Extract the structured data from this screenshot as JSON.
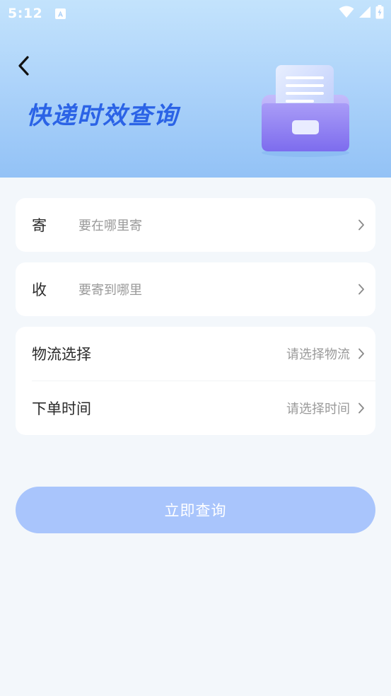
{
  "status_bar": {
    "time": "5:12",
    "notification_icon": "a-icon",
    "icons": [
      "wifi-icon",
      "signal-icon",
      "battery-charging-icon"
    ]
  },
  "header": {
    "back_icon": "chevron-left-icon",
    "title": "快递时效查询",
    "illustration": "document-drawer-icon"
  },
  "form": {
    "send": {
      "label": "寄",
      "placeholder": "要在哪里寄"
    },
    "receive": {
      "label": "收",
      "placeholder": "要寄到哪里"
    },
    "logistics": {
      "label": "物流选择",
      "value": "请选择物流"
    },
    "order_time": {
      "label": "下单时间",
      "value": "请选择时间"
    }
  },
  "submit": {
    "label": "立即查询"
  },
  "colors": {
    "title": "#2b63e6",
    "button": "#a9c5fc",
    "background": "#f3f7fb",
    "header_top": "#c3e3fc",
    "header_bottom": "#93c2f6"
  }
}
